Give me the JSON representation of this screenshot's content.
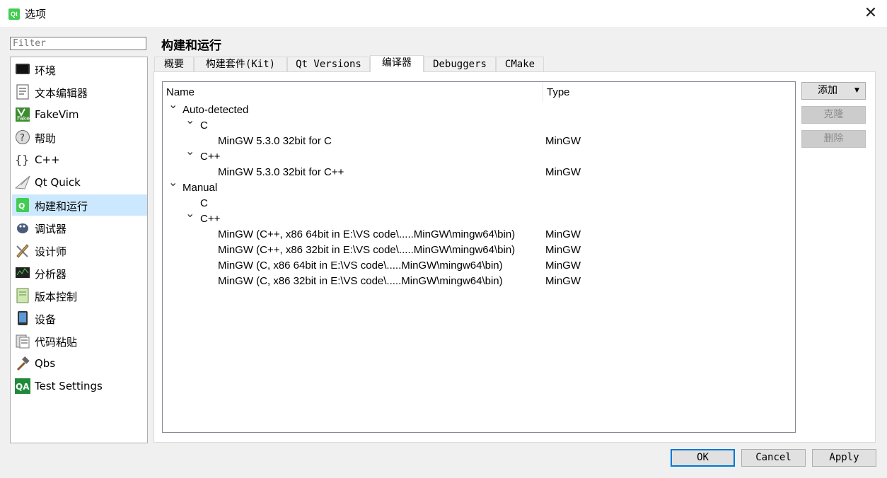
{
  "window": {
    "title": "选项",
    "app_icon_text": "Qt"
  },
  "filter": {
    "placeholder": "Filter"
  },
  "sidebar": {
    "items": [
      {
        "label": "环境",
        "icon": "monitor-icon"
      },
      {
        "label": "文本编辑器",
        "icon": "text-document-icon"
      },
      {
        "label": "FakeVim",
        "icon": "fakevim-icon"
      },
      {
        "label": "帮助",
        "icon": "help-icon"
      },
      {
        "label": "C++",
        "icon": "braces-icon"
      },
      {
        "label": "Qt Quick",
        "icon": "paper-plane-icon"
      },
      {
        "label": "构建和运行",
        "icon": "build-run-icon",
        "selected": true
      },
      {
        "label": "调试器",
        "icon": "bug-icon"
      },
      {
        "label": "设计师",
        "icon": "designer-icon"
      },
      {
        "label": "分析器",
        "icon": "analyzer-icon"
      },
      {
        "label": "版本控制",
        "icon": "version-control-icon"
      },
      {
        "label": "设备",
        "icon": "device-icon"
      },
      {
        "label": "代码粘贴",
        "icon": "code-paste-icon"
      },
      {
        "label": "Qbs",
        "icon": "hammer-icon"
      },
      {
        "label": "Test Settings",
        "icon": "qa-icon"
      }
    ]
  },
  "page": {
    "title": "构建和运行"
  },
  "tabs": [
    {
      "label": "概要"
    },
    {
      "label": "构建套件(Kit)"
    },
    {
      "label": "Qt Versions"
    },
    {
      "label": "编译器",
      "active": true
    },
    {
      "label": "Debuggers"
    },
    {
      "label": "CMake"
    }
  ],
  "tree": {
    "columns": {
      "name": "Name",
      "type": "Type"
    },
    "rows": [
      {
        "label": "Auto-detected",
        "type": "",
        "level": 0,
        "expanded": true
      },
      {
        "label": "C",
        "type": "",
        "level": 1,
        "expanded": true
      },
      {
        "label": "MinGW 5.3.0 32bit for C",
        "type": "MinGW",
        "level": 2
      },
      {
        "label": "C++",
        "type": "",
        "level": 1,
        "expanded": true
      },
      {
        "label": "MinGW 5.3.0 32bit for C++",
        "type": "MinGW",
        "level": 2
      },
      {
        "label": "Manual",
        "type": "",
        "level": 0,
        "expanded": true
      },
      {
        "label": "C",
        "type": "",
        "level": 1,
        "leaf": true
      },
      {
        "label": "C++",
        "type": "",
        "level": 1,
        "expanded": true
      },
      {
        "label": "MinGW (C++, x86 64bit in E:\\VS code\\.....MinGW\\mingw64\\bin)",
        "type": "MinGW",
        "level": 2
      },
      {
        "label": "MinGW (C++, x86 32bit in E:\\VS code\\.....MinGW\\mingw64\\bin)",
        "type": "MinGW",
        "level": 2
      },
      {
        "label": "MinGW (C, x86 64bit in E:\\VS code\\.....MinGW\\mingw64\\bin)",
        "type": "MinGW",
        "level": 2
      },
      {
        "label": "MinGW (C, x86 32bit in E:\\VS code\\.....MinGW\\mingw64\\bin)",
        "type": "MinGW",
        "level": 2
      }
    ]
  },
  "side_buttons": {
    "add": "添加",
    "clone": "克隆",
    "remove": "删除"
  },
  "dialog_buttons": {
    "ok": "OK",
    "cancel": "Cancel",
    "apply": "Apply"
  }
}
